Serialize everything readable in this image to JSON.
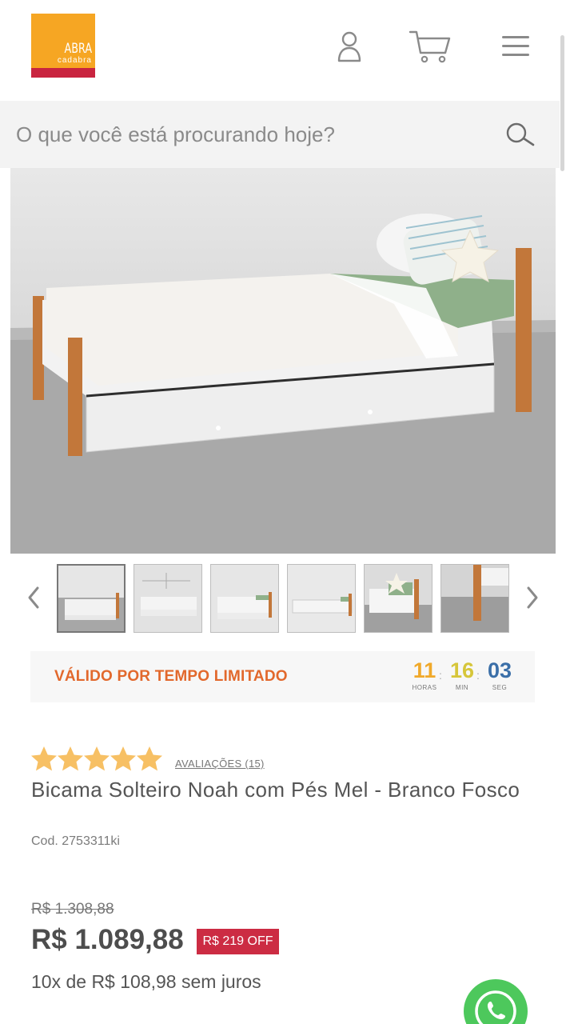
{
  "header": {
    "logo_text_top": "ABRA",
    "logo_text_bottom": "cadabra",
    "icons": [
      "user-icon",
      "cart-icon",
      "menu-icon"
    ]
  },
  "search": {
    "placeholder": "O que você está procurando hoje?",
    "icon": "search-icon"
  },
  "gallery": {
    "thumbnails_count": 6,
    "active_index": 0,
    "prev_icon": "chevron-left-icon",
    "next_icon": "chevron-right-icon"
  },
  "promo": {
    "label": "VÁLIDO POR TEMPO LIMITADO",
    "timer": [
      {
        "value": "11",
        "unit": "HORAS",
        "color": "#f0a92a"
      },
      {
        "value": "16",
        "unit": "MIN",
        "color": "#d6c63a"
      },
      {
        "value": "03",
        "unit": "SEG",
        "color": "#3b6fa8"
      }
    ]
  },
  "product": {
    "rating": 5,
    "reviews_label": "AVALIAÇÕES (15)",
    "title": "Bicama Solteiro Noah com Pés Mel - Branco Fosco",
    "code": "Cod. 2753311ki",
    "old_price": "R$ 1.308,88",
    "price": "R$ 1.089,88",
    "discount_badge": "R$ 219 OFF",
    "installments": "10x de R$ 108,98 sem juros"
  },
  "colors": {
    "logo_orange": "#f6a623",
    "logo_red": "#c9243f",
    "promo_orange": "#e2682c",
    "star": "#f7c064",
    "badge_red": "#cc2c43",
    "whatsapp_green": "#4dc85c"
  }
}
